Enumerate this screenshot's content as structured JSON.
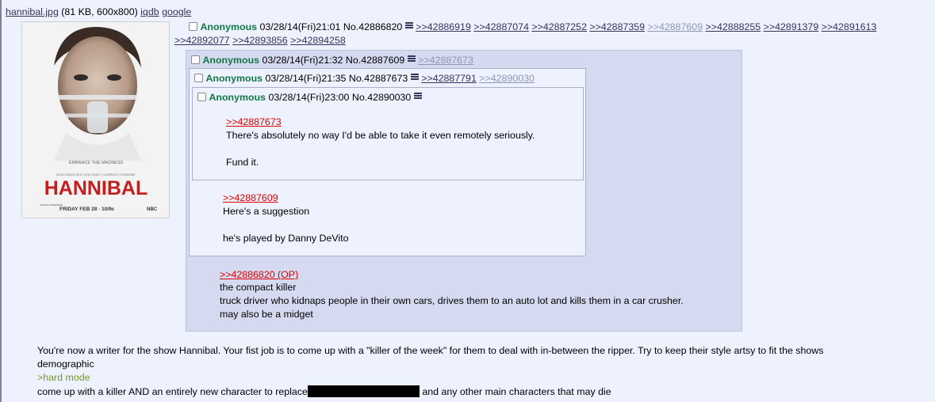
{
  "file": {
    "name": "hannibal.jpg",
    "meta": " (81 KB, 600x800) ",
    "iqdb": "iqdb",
    "google": "google"
  },
  "poster": {
    "tagline": "EMBRACE THE MADNESS",
    "cast": "MADS MIKKELSEN   HUGH DANCY   LAURENCE FISHBURNE",
    "title": "HANNIBAL",
    "airing": "FRIDAY FEB 28 · 10/9c",
    "network": "NBC",
    "premiere": "SEASON PREMIERE"
  },
  "op": {
    "name": "Anonymous",
    "datetime": "03/28/14(Fri)21:01",
    "no": "No.42886820",
    "replies_row1": [
      ">>42886919",
      ">>42887074",
      ">>42887252",
      ">>42887359",
      ">>42887609",
      ">>42888255",
      ">>42891379",
      ">>42891613"
    ],
    "replies_row2": [
      ">>42892077",
      ">>42893856",
      ">>42894258"
    ],
    "text1": "You're now a writer for the show Hannibal. Your fist job is to come up with a \"killer of the week\" for them to deal with in-between the ripper. Try to keep their style artsy to fit the shows",
    "text2": "demographic",
    "greentext": ">hard mode",
    "text3a": "come up with a killer AND an entirely new character to replace",
    "text3b": " and any other main characters that may die"
  },
  "post1": {
    "name": "Anonymous",
    "datetime": "03/28/14(Fri)21:32",
    "no": "No.42887609",
    "backlink": ">>42887673",
    "quote": ">>42886820 (OP)",
    "lines": [
      "the compact killer",
      "truck driver who kidnaps people in their own cars, drives them to an auto lot and kills them in a car crusher.",
      "may also be a midget"
    ]
  },
  "post2": {
    "name": "Anonymous",
    "datetime": "03/28/14(Fri)21:35",
    "no": "No.42887673",
    "backlink1": ">>42887791",
    "backlink2": ">>42890030",
    "quote": ">>42887609",
    "line1": "Here's a suggestion",
    "line2": "he's played by Danny DeVito"
  },
  "post3": {
    "name": "Anonymous",
    "datetime": "03/28/14(Fri)23:00",
    "no": "No.42890030",
    "quote": ">>42887673",
    "line1": "There's absolutely no way I'd be able to take it even remotely seriously.",
    "line2": "Fund it."
  }
}
